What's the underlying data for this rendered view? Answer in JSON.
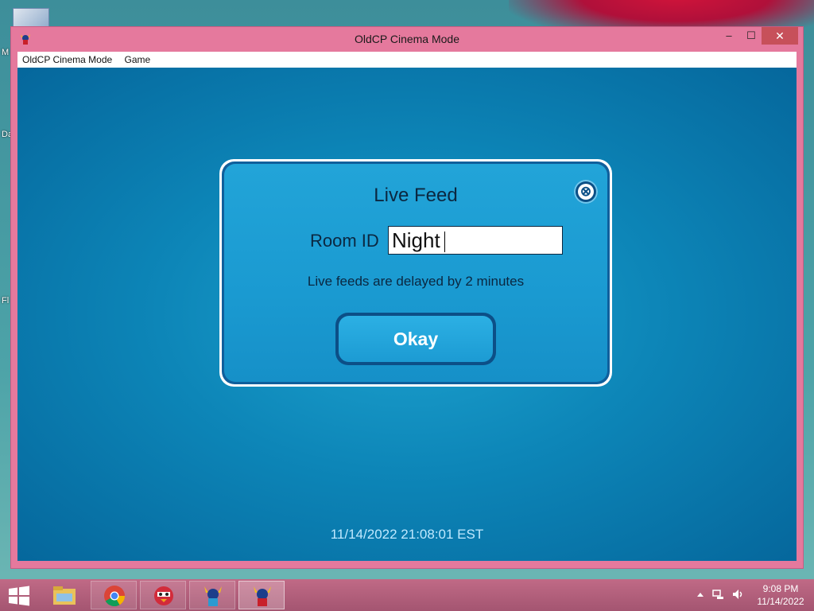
{
  "desktop": {
    "labels": [
      "M",
      "Da",
      "Fl"
    ]
  },
  "window": {
    "title": "OldCP Cinema Mode",
    "controls": {
      "minimize": "–",
      "maximize": "☐",
      "close": "✕"
    }
  },
  "menu": {
    "items": [
      "OldCP Cinema Mode",
      "Game"
    ]
  },
  "dialog": {
    "title": "Live Feed",
    "close_glyph": "⊗",
    "room_label": "Room ID",
    "room_value": "Night",
    "note": "Live feeds are delayed by 2 minutes",
    "okay_label": "Okay"
  },
  "status": {
    "timestamp": "11/14/2022 21:08:01 EST"
  },
  "taskbar": {
    "apps": [
      {
        "name": "file-explorer",
        "state": "idle"
      },
      {
        "name": "chrome",
        "state": "open"
      },
      {
        "name": "penguin-red",
        "state": "open"
      },
      {
        "name": "viking-penguin",
        "state": "open"
      },
      {
        "name": "viking-penguin",
        "state": "active"
      }
    ],
    "tray_icons": [
      "chevron-up-icon",
      "network-icon",
      "volume-icon"
    ],
    "time": "9:08 PM",
    "date": "11/14/2022"
  },
  "colors": {
    "window_frame": "#e5799d",
    "client_bg": "#0d86b8",
    "dialog_face": "#1a9ad1",
    "dialog_border": "#0f5f9c",
    "taskbar": "#a45571"
  }
}
